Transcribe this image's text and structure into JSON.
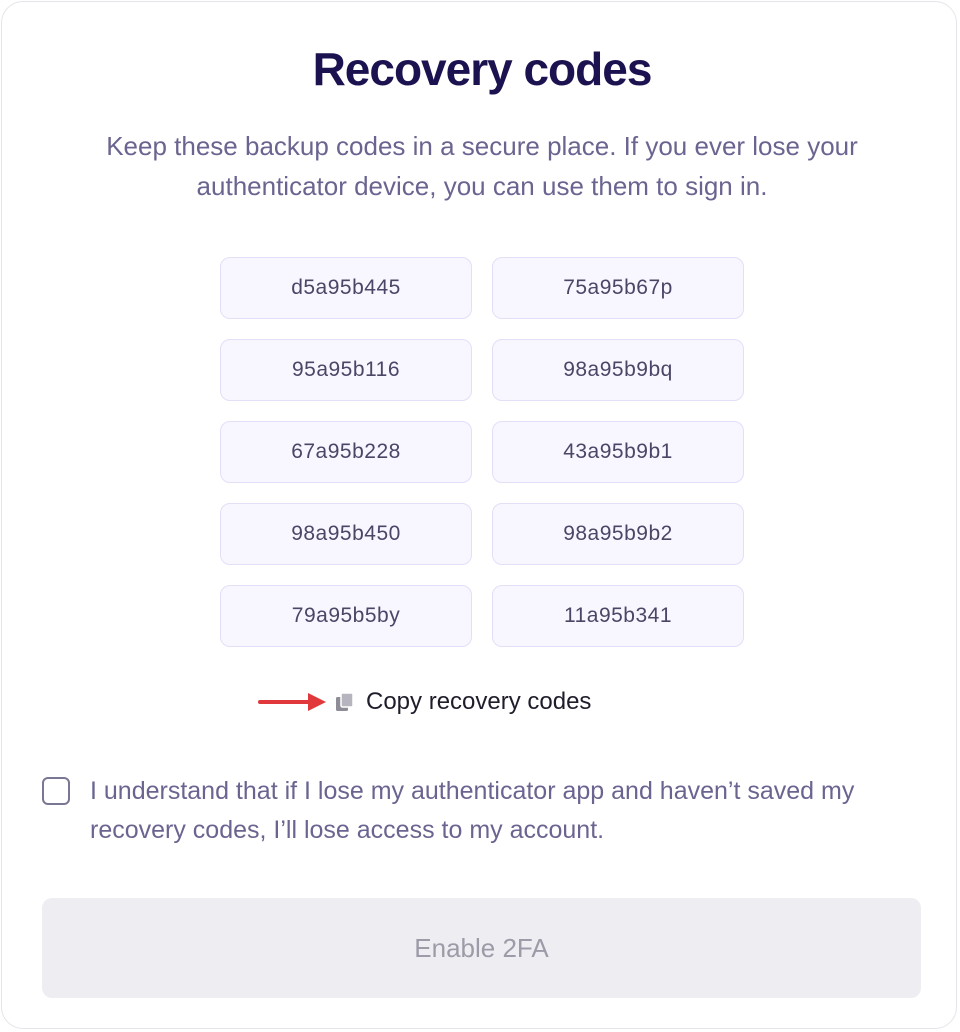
{
  "dialog": {
    "title": "Recovery codes",
    "subtitle": "Keep these backup codes in a secure place. If you ever lose your authenticator device, you can use them to sign in."
  },
  "codes": [
    "d5a95b445",
    "75a95b67p",
    "95a95b116",
    "98a95b9bq",
    "67a95b228",
    "43a95b9b1",
    "98a95b450",
    "98a95b9b2",
    "79a95b5by",
    "11a95b341"
  ],
  "copy": {
    "label": "Copy recovery codes",
    "icon": "copy-icon"
  },
  "annotation": {
    "arrow_color": "#e0383b"
  },
  "acknowledge": {
    "checked": false,
    "label": "I understand that if I lose my authenticator app and haven’t saved my recovery codes, I’ll lose access to my account."
  },
  "enable_button": {
    "label": "Enable 2FA",
    "disabled": true
  },
  "colors": {
    "title": "#1b1250",
    "body_text": "#6a6590",
    "code_bg": "#f8f6ff",
    "code_border": "#e4def8",
    "button_disabled_bg": "#eeedf2"
  }
}
